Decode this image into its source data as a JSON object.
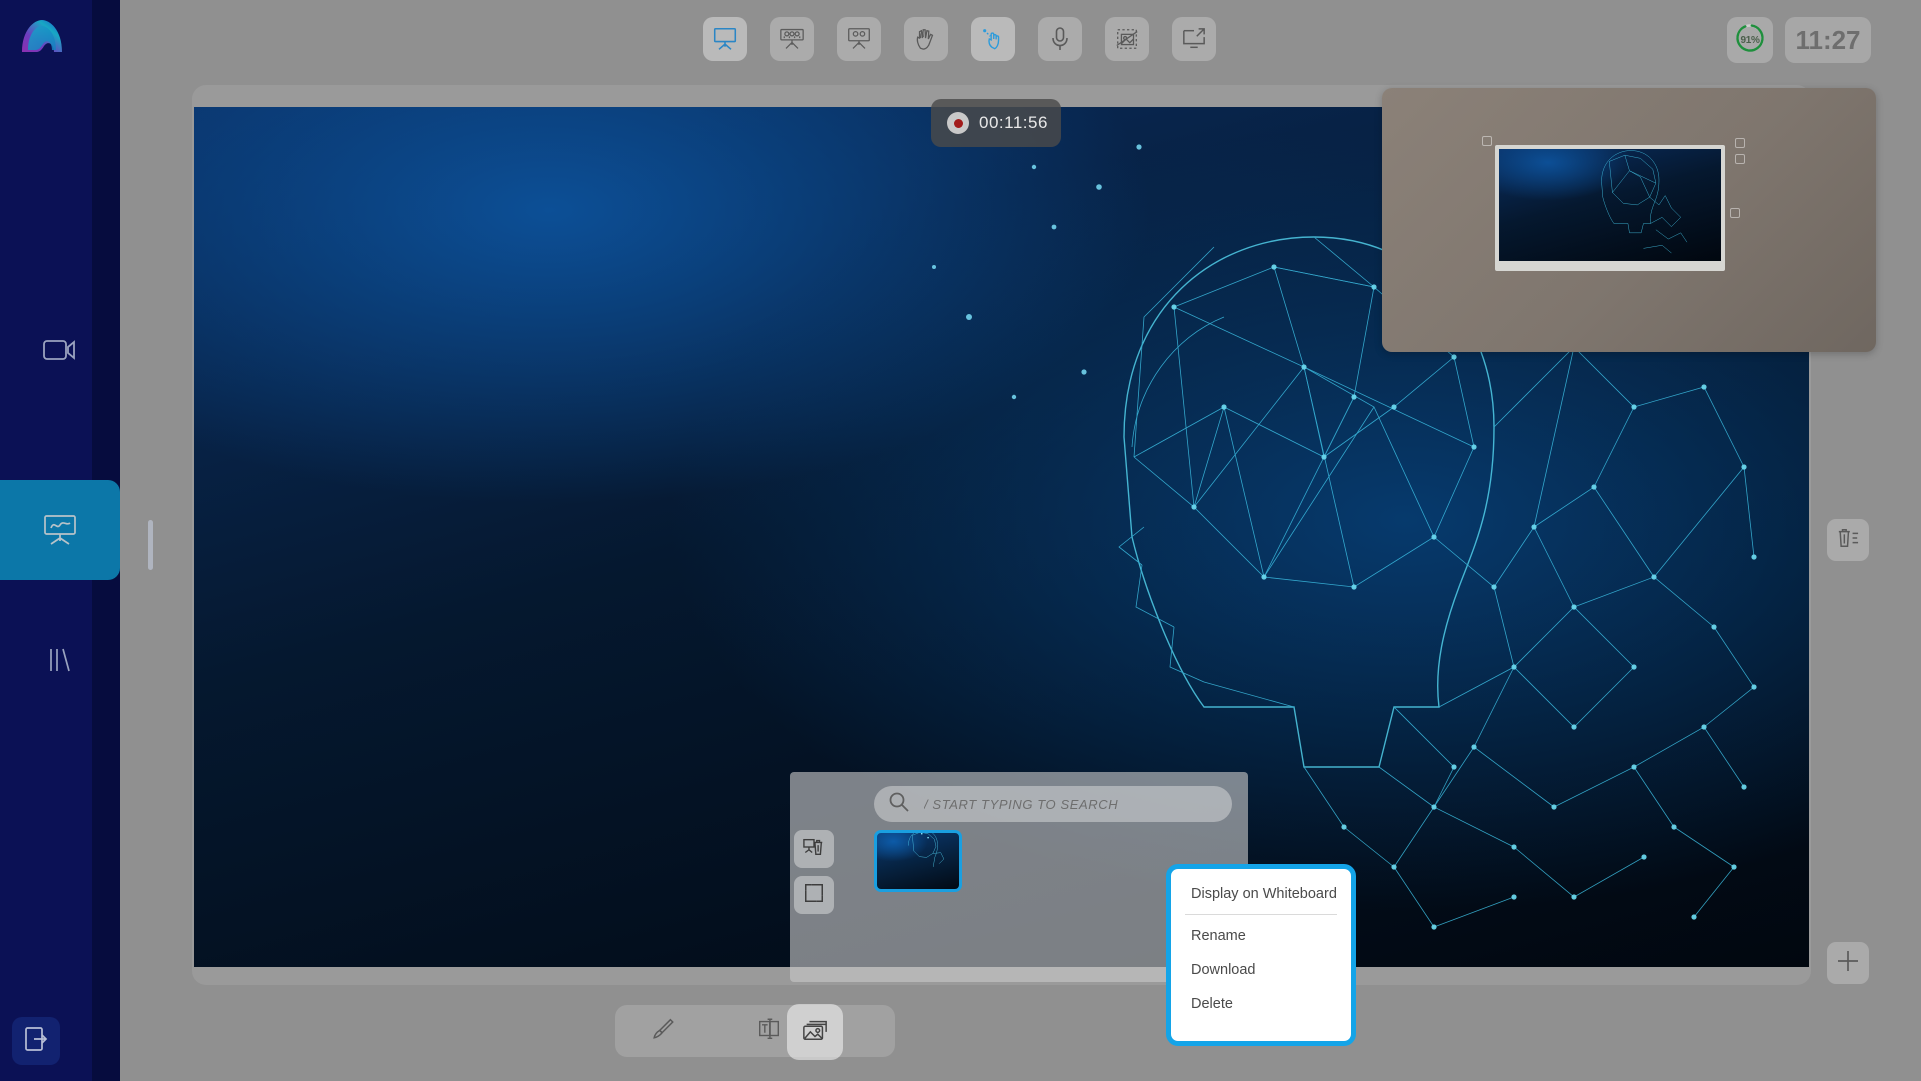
{
  "app": {
    "logo_name": "aurora-arch-logo",
    "accent_blue": "#14a4e8",
    "sidebar_bg": "#0b1155",
    "active_nav_bg": "#0c77a8"
  },
  "sidebar": {
    "items": [
      {
        "id": "video",
        "icon": "video-camera-icon",
        "label": "Video",
        "active": false
      },
      {
        "id": "whiteboard",
        "icon": "whiteboard-easel-icon",
        "label": "Whiteboard",
        "active": true
      },
      {
        "id": "library",
        "icon": "library-bars-icon",
        "label": "Library",
        "active": false
      }
    ],
    "exit": {
      "icon": "exit-door-icon",
      "label": "Exit"
    }
  },
  "toolbar": {
    "items": [
      {
        "id": "whiteboard-mode",
        "icon": "whiteboard-easel-icon",
        "label": "Whiteboard",
        "active": true
      },
      {
        "id": "audience-view",
        "icon": "audience-board-icon",
        "label": "Audience View",
        "active": false
      },
      {
        "id": "presenter-view",
        "icon": "presenter-board-icon",
        "label": "Presenter View",
        "active": false
      },
      {
        "id": "raise-hand",
        "icon": "raised-hands-icon",
        "label": "Raise Hand",
        "active": false
      },
      {
        "id": "pointer",
        "icon": "pointer-hand-icon",
        "label": "Pointer",
        "active": true
      },
      {
        "id": "microphone",
        "icon": "microphone-icon",
        "label": "Microphone",
        "active": false
      },
      {
        "id": "snapshot",
        "icon": "image-capture-icon",
        "label": "Snapshot",
        "active": false
      },
      {
        "id": "share-screen",
        "icon": "screen-share-icon",
        "label": "Share Screen",
        "active": false
      }
    ]
  },
  "status": {
    "battery": {
      "percent_label": "91%",
      "percent": 91,
      "color": "#1f8f3d",
      "icon": "battery-ring-icon"
    },
    "clock": "11:27"
  },
  "recording": {
    "icon": "record-dot-icon",
    "elapsed": "00:11:56"
  },
  "whiteboard": {
    "title": "Whiteboard Canvas",
    "image_alt": "ai-network-head-artwork"
  },
  "preview_panel": {
    "name": "mini-whiteboard-preview",
    "image_alt": "ai-network-head-artwork"
  },
  "edge_buttons": [
    {
      "id": "delete",
      "icon": "trash-list-icon",
      "label": "Delete"
    },
    {
      "id": "add",
      "icon": "crosshair-plus-icon",
      "label": "Add"
    }
  ],
  "bottom_tools": [
    {
      "id": "brush",
      "icon": "paint-brush-icon",
      "label": "Brush",
      "active": false
    },
    {
      "id": "text",
      "icon": "text-tool-icon",
      "label": "Text",
      "active": false
    },
    {
      "id": "images",
      "icon": "images-stack-icon",
      "label": "Images",
      "active": true
    }
  ],
  "library": {
    "search": {
      "icon": "search-icon",
      "placeholder": "/ START TYPING TO SEARCH",
      "value": ""
    },
    "side_actions": [
      {
        "id": "clear-board",
        "icon": "clear-whiteboard-trash-icon",
        "label": "Clear Whiteboard"
      },
      {
        "id": "expand",
        "icon": "expand-corners-icon",
        "label": "Expand"
      }
    ],
    "thumbnails": [
      {
        "id": "thumb-1",
        "alt": "ai-network-head-thumbnail",
        "selected": true
      }
    ]
  },
  "context_menu": {
    "items": [
      {
        "id": "display-on-whiteboard",
        "label": "Display on Whiteboard",
        "separator_after": true
      },
      {
        "id": "rename",
        "label": "Rename",
        "separator_after": false
      },
      {
        "id": "download",
        "label": "Download",
        "separator_after": false
      },
      {
        "id": "delete",
        "label": "Delete",
        "separator_after": false
      }
    ]
  }
}
